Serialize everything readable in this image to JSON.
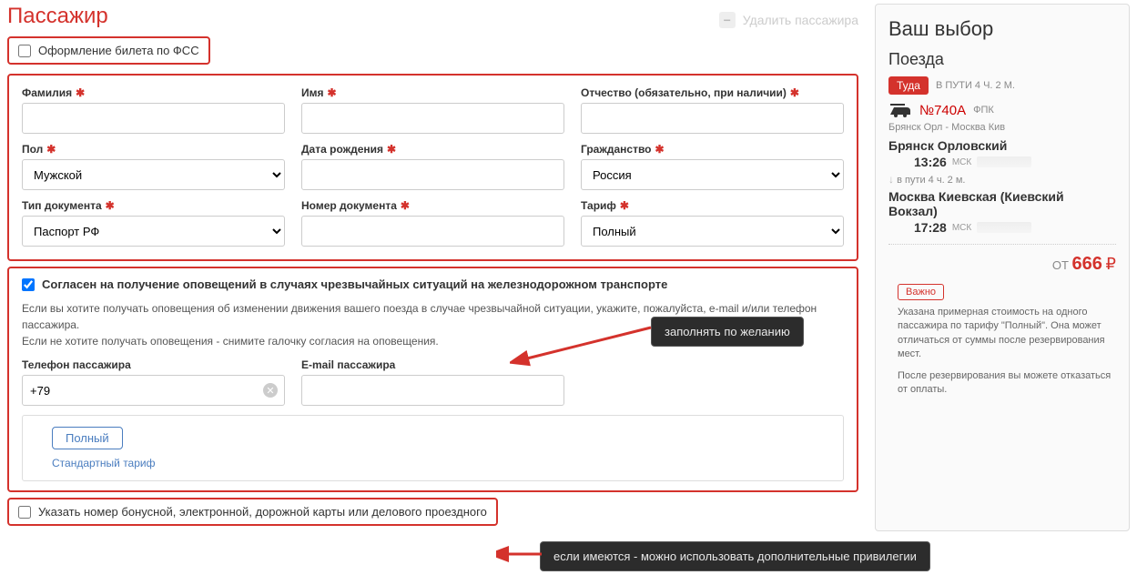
{
  "title": "Пассажир",
  "remove_passenger": "Удалить пассажира",
  "fss_label": "Оформление билета по ФСС",
  "fields": {
    "surname": "Фамилия",
    "name": "Имя",
    "patronymic": "Отчество (обязательно, при наличии)",
    "gender": "Пол",
    "dob": "Дата рождения",
    "citizenship": "Гражданство",
    "doctype": "Тип документа",
    "docnum": "Номер документа",
    "tariff": "Тариф",
    "phone": "Телефон пассажира",
    "email": "E-mail пассажира"
  },
  "values": {
    "gender": "Мужской",
    "citizenship": "Россия",
    "doctype": "Паспорт РФ",
    "tariff": "Полный",
    "phone": "+79"
  },
  "notifications": {
    "checkbox_label": "Согласен на получение оповещений в случаях чрезвычайных ситуаций на железнодорожном транспорте",
    "hint": "Если вы хотите получать оповещения об изменении движения вашего поезда в случае чрезвычайной ситуации, укажите, пожалуйста, e-mail и/или телефон пассажира.\nЕсли не хотите получать оповещения - снимите галочку согласия на оповещения."
  },
  "tariff_box": {
    "pill": "Полный",
    "desc": "Стандартный тариф"
  },
  "bonus_label": "Указать номер бонусной, электронной, дорожной карты или делового проездного",
  "callouts": {
    "optional": "заполнять по желанию",
    "bonus": "если имеются - можно использовать дополнительные привилегии"
  },
  "sidebar": {
    "header": "Ваш выбор",
    "trains_label": "Поезда",
    "direction": "Туда",
    "travel_time_top": "В ПУТИ 4 Ч. 2 М.",
    "train_no": "№740А",
    "operator": "ФПК",
    "route_small": "Брянск Орл - Москва Кив",
    "from": "Брянск Орловский",
    "from_time": "13:26",
    "tz": "МСК",
    "enroute": "в пути  4 ч. 2 м.",
    "to": "Москва Киевская (Киевский Вокзал)",
    "to_time": "17:28",
    "price_prefix": "ОТ",
    "price": "666",
    "currency": "₽",
    "important": "Важно",
    "imp1": "Указана примерная стоимость на одного пассажира по тарифу \"Полный\". Она может отличаться от суммы после резервирования мест.",
    "imp2": "После резервирования вы можете отказаться от оплаты."
  }
}
